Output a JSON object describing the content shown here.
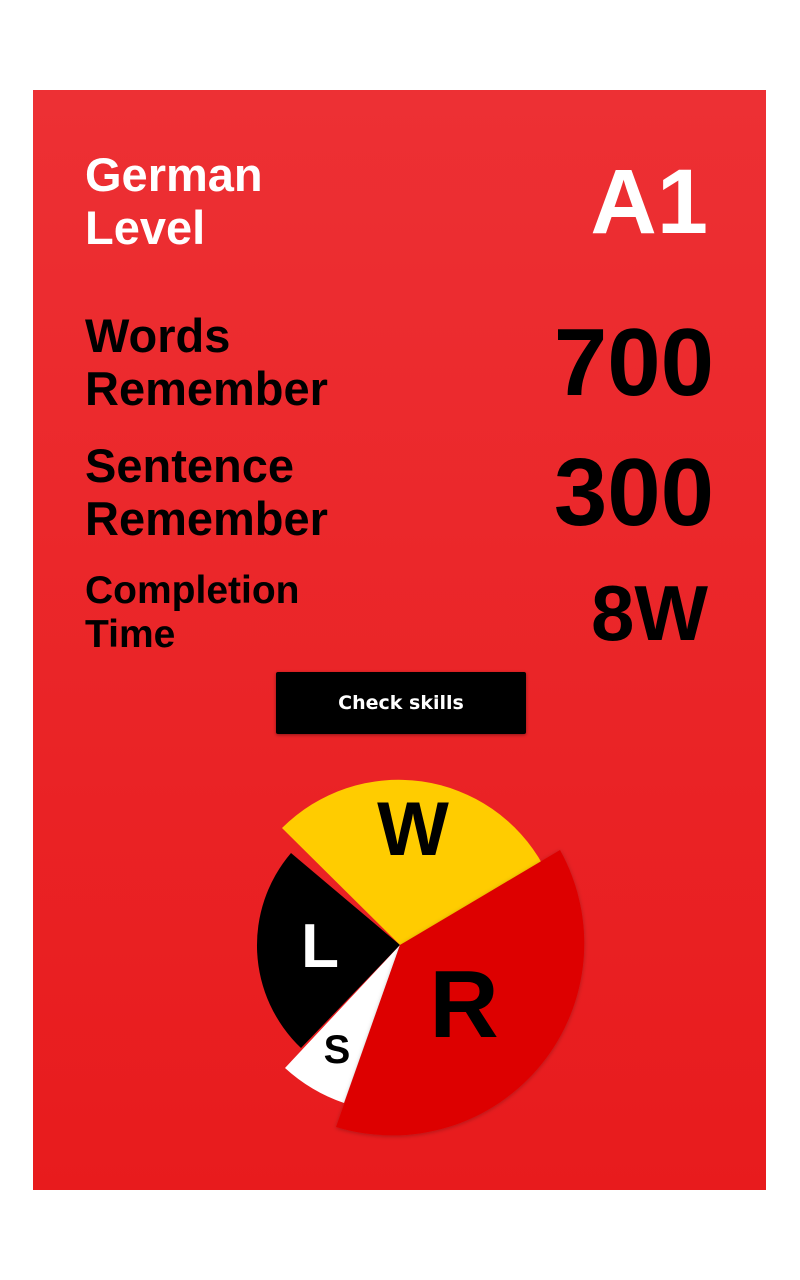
{
  "level": {
    "label_line1": "German",
    "label_line2": "Level",
    "value": "A1"
  },
  "stats": {
    "words": {
      "label_line1": "Words",
      "label_line2": "Remember",
      "value": "700"
    },
    "sentences": {
      "label_line1": "Sentence",
      "label_line2": "Remember",
      "value": "300"
    },
    "completion": {
      "label_line1": "Completion",
      "label_line2": "Time",
      "value": "8W"
    }
  },
  "button": {
    "label": "Check skills"
  },
  "colors": {
    "card_background": "#ec2628",
    "writing": "#ffcc00",
    "reading": "#dd0000",
    "speaking": "#ffffff",
    "listening": "#000000"
  },
  "skills_wheel": {
    "segments": [
      {
        "key": "writing",
        "letter": "W"
      },
      {
        "key": "reading",
        "letter": "R"
      },
      {
        "key": "speaking",
        "letter": "S"
      },
      {
        "key": "listening",
        "letter": "L"
      }
    ]
  }
}
